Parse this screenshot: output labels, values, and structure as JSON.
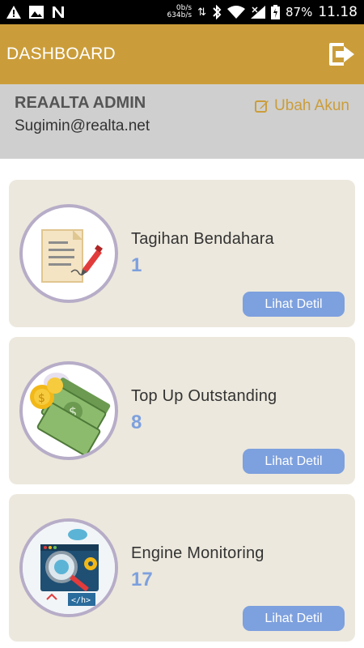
{
  "status": {
    "net_up": "0b/s",
    "net_down": "634b/s",
    "battery": "87%",
    "time": "11.18"
  },
  "appbar": {
    "title": "DASHBOARD",
    "color": "#CB9D3A"
  },
  "account": {
    "name": "REAALTA ADMIN",
    "email": "Sugimin@realta.net",
    "edit_label": "Ubah Akun"
  },
  "cards": [
    {
      "label": "Tagihan Bendahara",
      "count": "1",
      "button": "Lihat Detil",
      "icon": "invoice-document-pen-icon"
    },
    {
      "label": "Top Up Outstanding",
      "count": "8",
      "button": "Lihat Detil",
      "icon": "money-coins-icon"
    },
    {
      "label": "Engine Monitoring",
      "count": "17",
      "button": "Lihat Detil",
      "icon": "engine-monitoring-gears-icon"
    }
  ],
  "colors": {
    "accent": "#CB9D3A",
    "card_bg": "#ECE8DD",
    "count": "#7DA0DE",
    "button": "#7DA0DE",
    "avatar_ring": "#B7ADC8"
  }
}
